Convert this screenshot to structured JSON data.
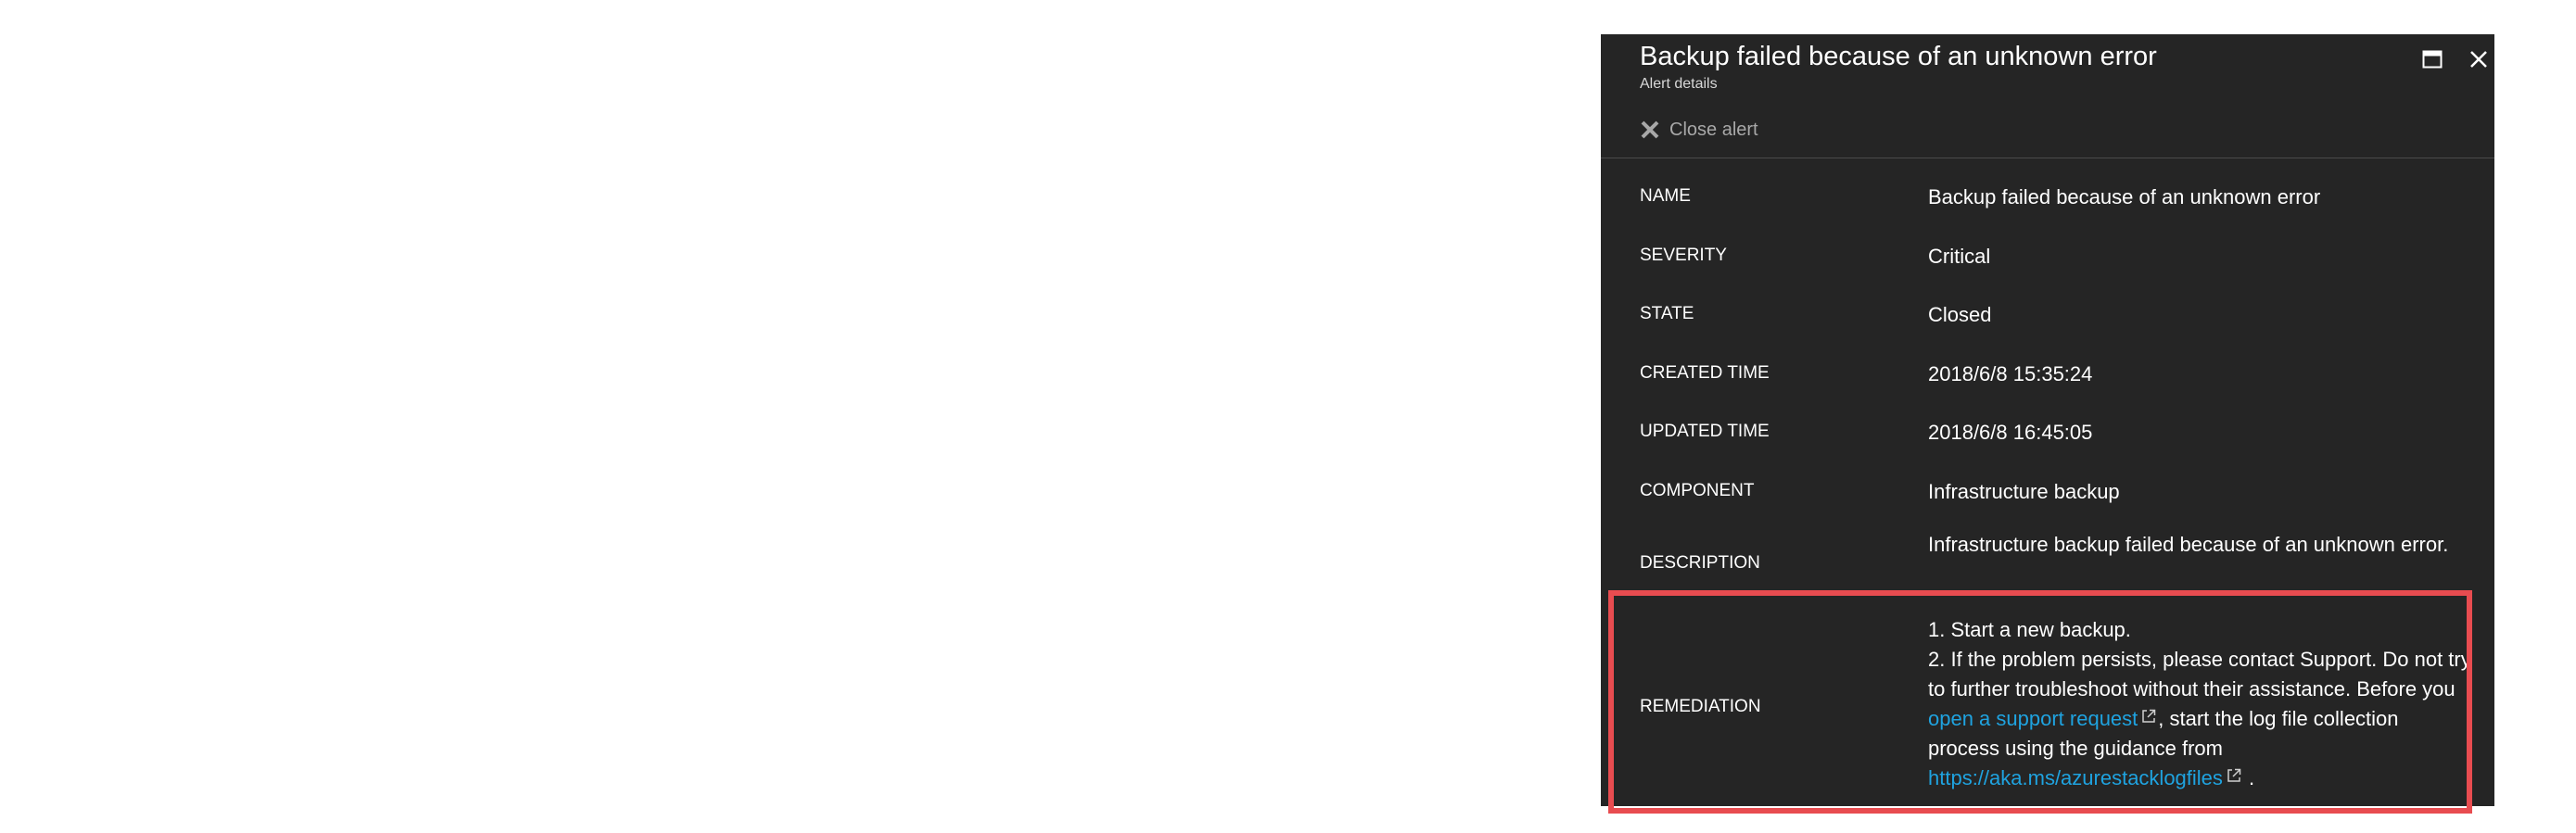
{
  "blade": {
    "title": "Backup failed because of an unknown error",
    "subtitle": "Alert details",
    "close_alert_label": "Close alert",
    "maximize_icon": "maximize-icon",
    "close_icon": "close-icon"
  },
  "fields": {
    "name": {
      "label": "NAME",
      "value": "Backup failed because of an unknown error"
    },
    "severity": {
      "label": "SEVERITY",
      "value": "Critical"
    },
    "state": {
      "label": "STATE",
      "value": "Closed"
    },
    "created_time": {
      "label": "CREATED TIME",
      "value": "2018/6/8 15:35:24"
    },
    "updated_time": {
      "label": "UPDATED TIME",
      "value": "2018/6/8 16:45:05"
    },
    "component": {
      "label": "COMPONENT",
      "value": "Infrastructure backup"
    },
    "description": {
      "label": "DESCRIPTION",
      "value": "Infrastructure backup failed because of an unknown error."
    },
    "remediation": {
      "label": "REMEDIATION",
      "line1": "1. Start a new backup.",
      "line2_before_link": "2. If the problem persists, please contact Support. Do not try to further troubleshoot without their assistance. Before you",
      "support_link": "open a support request",
      "line2_middle": ", start the log file collection process using the guidance from",
      "logfiles_link": "https://aka.ms/azurestacklogfiles",
      "line2_end": "."
    }
  },
  "colors": {
    "blade_background": "#252525",
    "link": "#1fa3e0",
    "highlight_border": "#e84c50"
  }
}
